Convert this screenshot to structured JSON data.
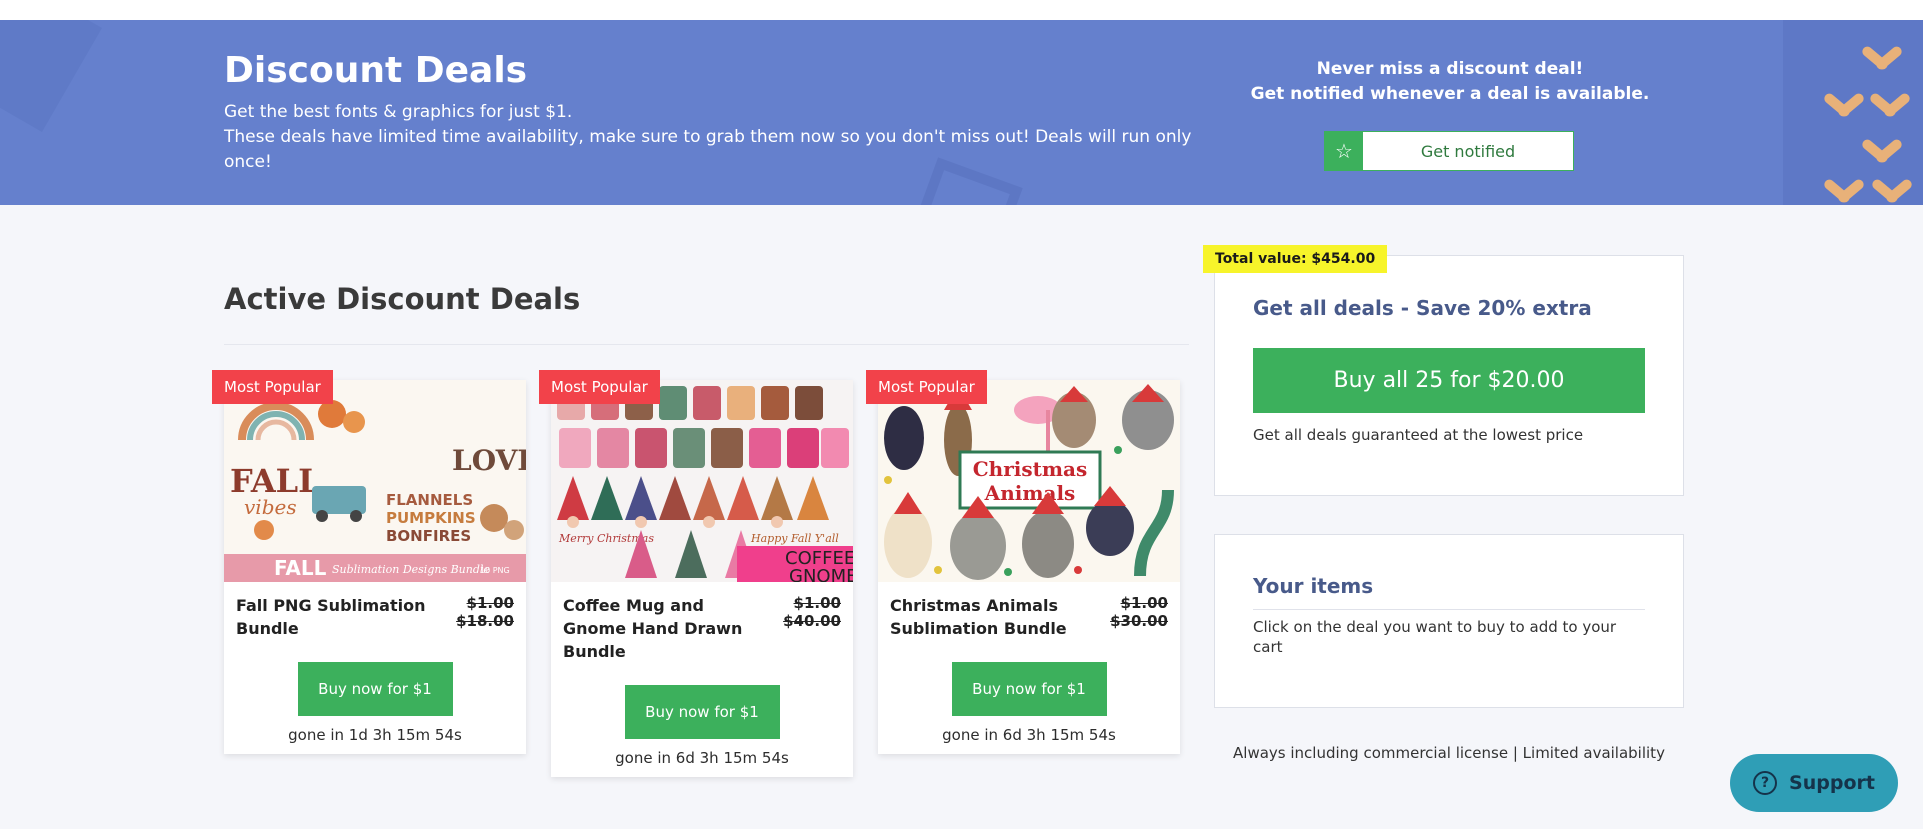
{
  "banner": {
    "title": "Discount Deals",
    "subtitle_line1": "Get the best fonts & graphics for just $1.",
    "subtitle_line2": "These deals have limited time availability, make sure to grab them now so you don't miss out! Deals will run only once!",
    "notify_line1": "Never miss a discount deal!",
    "notify_line2": "Get notified whenever a deal is available.",
    "notify_button": "Get notified",
    "colors": {
      "background": "#6580cd",
      "accent": "#e8b179"
    }
  },
  "main": {
    "section_title": "Active Discount Deals",
    "deals": [
      {
        "badge": "Most Popular",
        "title": "Fall PNG Sublimation Bundle",
        "price": "$1.00",
        "old_price": "$18.00",
        "button": "Buy now for $1",
        "timer": "gone in 1d 3h 15m 54s",
        "image_text": {
          "fall": "FALL",
          "vibes": "vibes",
          "love": "LOVE",
          "flannels": "FLANNELS",
          "pumpkins": "PUMPKINS",
          "bonfires": "BONFIRES",
          "banner": "FALL",
          "banner_sub": "Sublimation Designs Bundle",
          "png": "10 PNG"
        }
      },
      {
        "badge": "Most Popular",
        "title": "Coffee Mug and Gnome Hand Drawn Bundle",
        "price": "$1.00",
        "old_price": "$40.00",
        "button": "Buy now for $1",
        "timer": "gone in 6d 3h 15m 54s",
        "image_text": {
          "coffee": "COFFEE",
          "gnome": "GNOME",
          "christmas": "Merry Christmas",
          "happy": "Happy Fall Y'all"
        }
      },
      {
        "badge": "Most Popular",
        "title": "Christmas Animals Sublimation Bundle",
        "price": "$1.00",
        "old_price": "$30.00",
        "button": "Buy now for $1",
        "timer": "gone in 6d 3h 15m 54s",
        "image_text": {
          "line1": "Christmas",
          "line2": "Animals"
        }
      }
    ]
  },
  "sidebar": {
    "total_value": "Total value: $454.00",
    "bundle_title": "Get all deals - Save 20% extra",
    "bundle_button": "Buy all 25 for $20.00",
    "bundle_note": "Get all deals guaranteed at the lowest price",
    "items_title": "Your items",
    "items_note": "Click on the deal you want to buy to add to your cart",
    "footer_note": "Always including commercial license | Limited availability"
  },
  "support": {
    "label": "Support",
    "icon": "question-icon"
  },
  "colors": {
    "green": "#3cb05c",
    "badge_red": "#f2424a",
    "highlight_yellow": "#f7f42a",
    "support_teal": "#2f9eb6"
  }
}
